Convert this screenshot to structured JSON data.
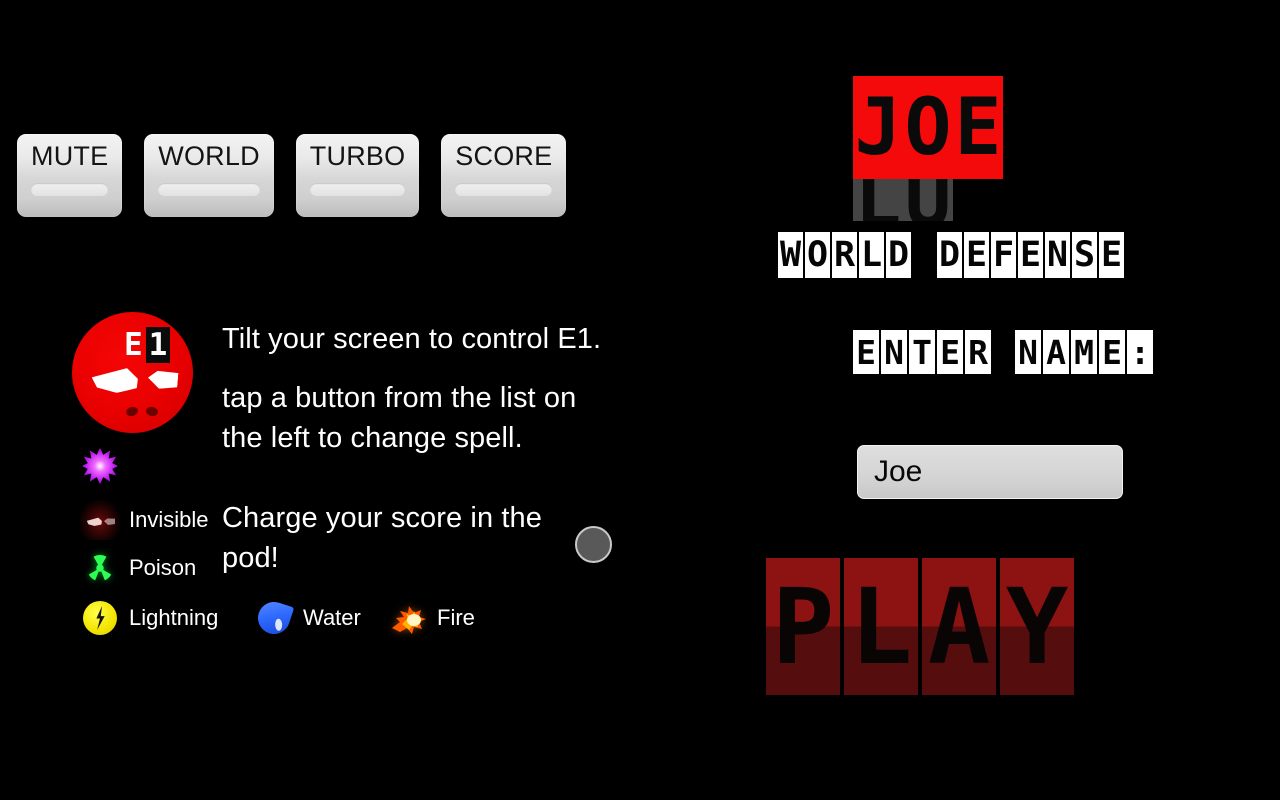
{
  "background_color": "#000000",
  "toolbar": {
    "buttons": [
      {
        "label": "MUTE",
        "name": "mute-button"
      },
      {
        "label": "WORLD",
        "name": "world-button"
      },
      {
        "label": "TURBO",
        "name": "turbo-button"
      },
      {
        "label": "SCORE",
        "name": "score-button"
      }
    ]
  },
  "avatar": {
    "name": "e1-character",
    "tag_letter": "E",
    "tag_number": "1",
    "color": "#e80000"
  },
  "instructions": {
    "line1": "Tilt your screen to control E1.",
    "line2": "tap a button from the list on the left to change spell.",
    "line3": "Charge your score in the pod!"
  },
  "spells": [
    {
      "icon": "nova-starburst-icon",
      "label": "",
      "color": "#c01ef0"
    },
    {
      "icon": "invisible-eyes-icon",
      "label": "Invisible",
      "color": "#780c0c"
    },
    {
      "icon": "poison-radiation-icon",
      "label": "Poison",
      "color": "#00ff3c"
    },
    {
      "icon": "lightning-bolt-icon",
      "label": "Lightning",
      "color": "#f2e400"
    },
    {
      "icon": "water-droplet-icon",
      "label": "Water",
      "color": "#2f6bff"
    },
    {
      "icon": "fire-flame-icon",
      "label": "Fire",
      "color": "#ff7800"
    }
  ],
  "pod": {
    "name": "score-pod",
    "color": "#595959"
  },
  "title": {
    "logo_letters": [
      "J",
      "O",
      "E"
    ],
    "logo_under_letters": [
      "L",
      "U"
    ],
    "logo_color": "#f40a0a",
    "logo_under_color": "#444444",
    "subtitle": "WORLD DEFENSE",
    "prompt": "ENTER NAME:"
  },
  "name_field": {
    "value": "Joe",
    "placeholder": "Enter name"
  },
  "play_button": {
    "label": "PLAY",
    "color_top": "#8d1212",
    "color_bottom": "#560d0d"
  }
}
